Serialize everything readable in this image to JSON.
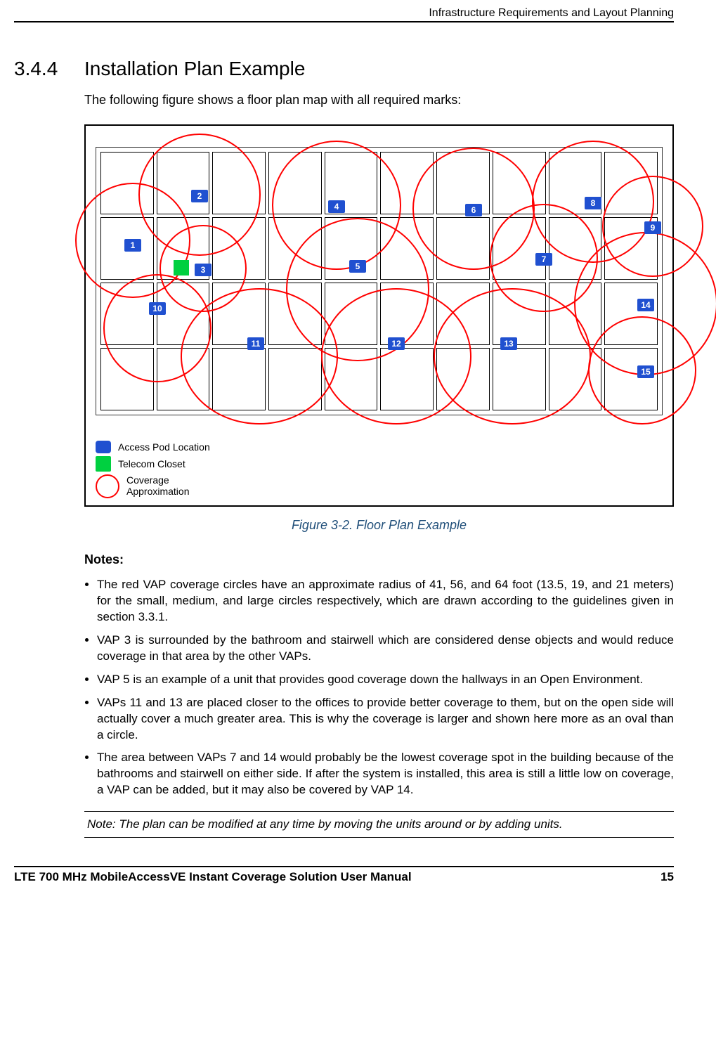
{
  "header": {
    "running_title": "Infrastructure Requirements and Layout Planning"
  },
  "section": {
    "number": "3.4.4",
    "title": "Installation Plan Example"
  },
  "intro": "The following figure shows a floor plan map with all required marks:",
  "figure": {
    "caption": "Figure 3-2. Floor Plan Example",
    "legend": {
      "access_pod": "Access Pod Location",
      "telecom_closet": "Telecom Closet",
      "coverage_1": "Coverage",
      "coverage_2": "Approximation"
    },
    "vap_labels": [
      "1",
      "2",
      "3",
      "4",
      "5",
      "6",
      "7",
      "8",
      "9",
      "10",
      "11",
      "12",
      "13",
      "14",
      "15"
    ]
  },
  "notes_heading": "Notes:",
  "notes": [
    "The red VAP coverage circles have an approximate radius of 41, 56, and 64 foot (13.5, 19, and 21 meters) for the small, medium, and large circles respectively, which are drawn according to the guidelines given in section 3.3.1.",
    "VAP 3 is surrounded by the bathroom and stairwell which are considered dense objects and would reduce coverage in that area by the other VAPs.",
    "VAP 5 is an example of a unit that provides good coverage down the hallways in an Open Environment.",
    "VAPs 11 and 13 are placed closer to the offices to provide better coverage to them, but on the open side will actually cover a much greater area. This is why the coverage is larger and shown here more as an oval than a circle.",
    "The area between VAPs 7 and 14 would probably be the lowest coverage spot in the building because of the bathrooms and stairwell on either side. If after the system is installed, this area is still a little low on coverage, a VAP can be added, but it may also be covered by VAP 14."
  ],
  "callout_note": "Note: The plan can be modified at any time by moving the units around or by adding units.",
  "footer": {
    "doc_title": "LTE 700 MHz MobileAccessVE Instant Coverage Solution User Manual",
    "page_number": "15"
  }
}
